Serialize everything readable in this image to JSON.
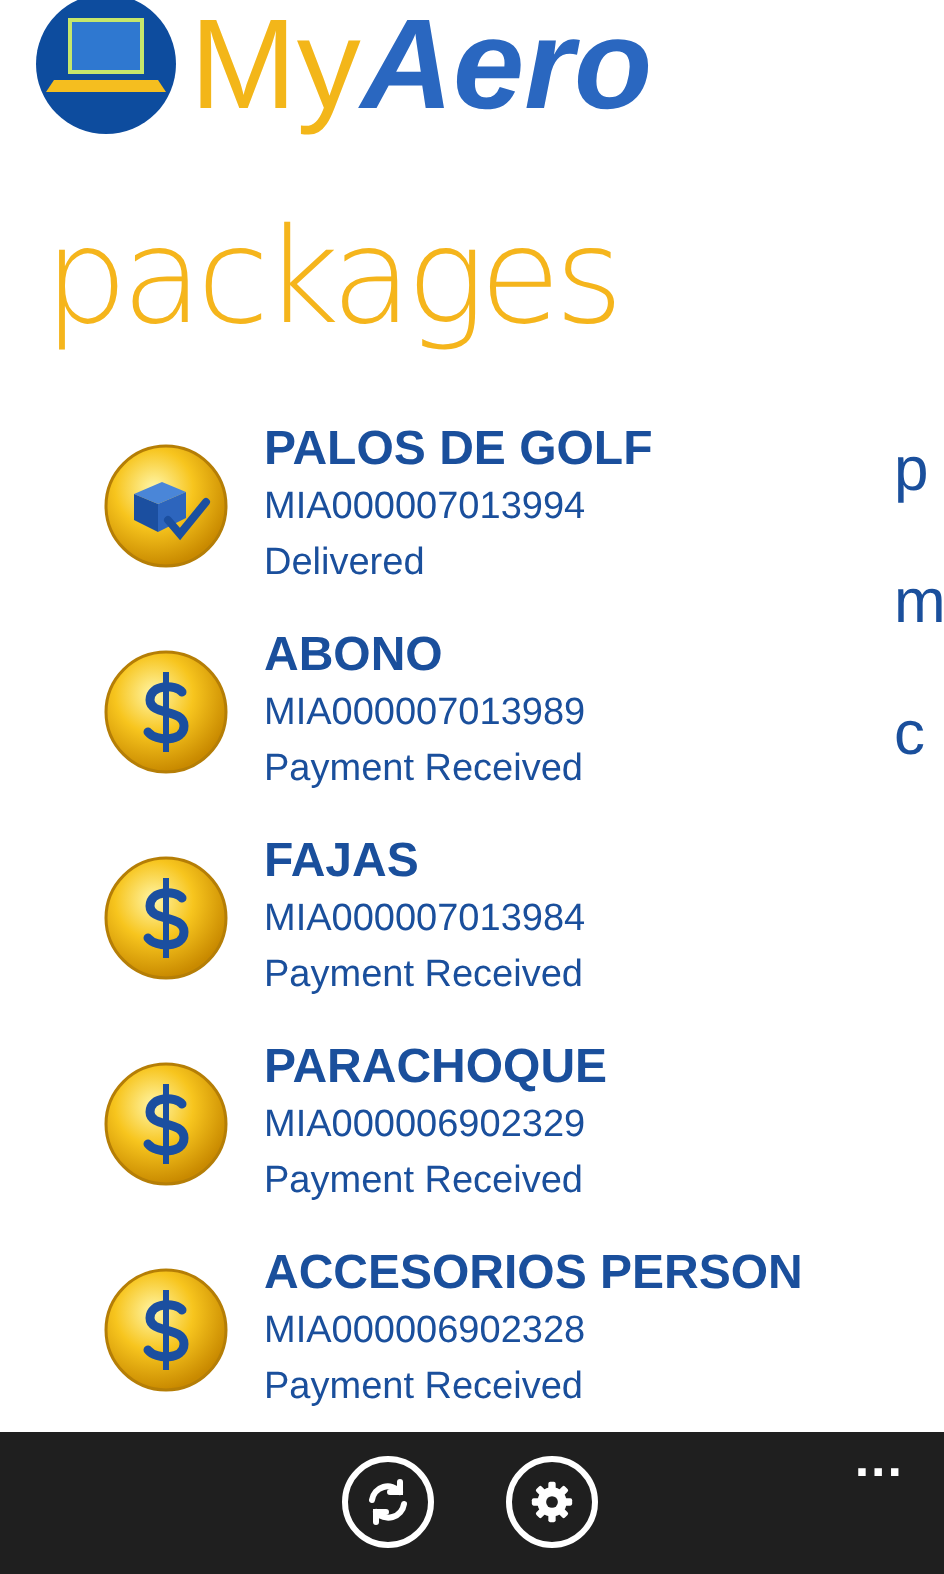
{
  "logo": {
    "part_1": "My",
    "part_2": "Aero"
  },
  "pivot": [
    {
      "label": "packages",
      "selected": true
    }
  ],
  "packages": [
    {
      "kind": "delivered",
      "name": "PALOS DE GOLF",
      "tracking": "MIA000007013994",
      "status": "Delivered"
    },
    {
      "kind": "payment",
      "name": "ABONO",
      "tracking": "MIA000007013989",
      "status": "Payment Received"
    },
    {
      "kind": "payment",
      "name": "FAJAS",
      "tracking": "MIA000007013984",
      "status": "Payment Received"
    },
    {
      "kind": "payment",
      "name": "PARACHOQUE",
      "tracking": "MIA000006902329",
      "status": "Payment Received"
    },
    {
      "kind": "payment",
      "name": "ACCESORIOS PERSON",
      "tracking": "MIA000006902328",
      "status": "Payment Received"
    }
  ],
  "next_pane": [
    "p",
    "m",
    "c"
  ],
  "app_bar": {
    "more": "..."
  }
}
